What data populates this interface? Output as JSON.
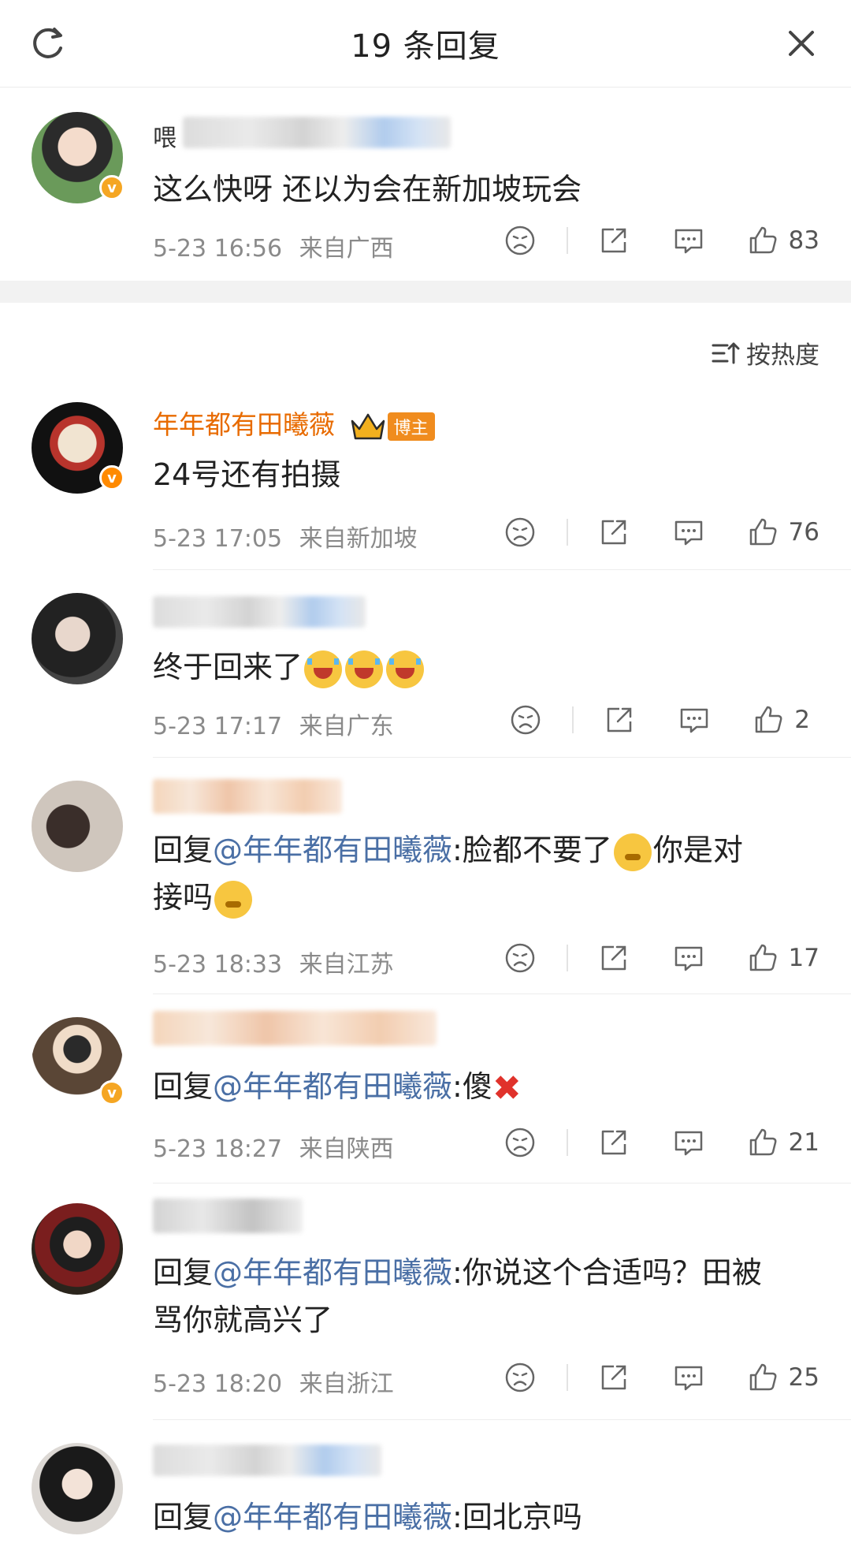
{
  "header": {
    "title": "19 条回复"
  },
  "root": {
    "name": "喂",
    "text": "这么快呀 还以为会在新加坡玩会",
    "time": "5-23 16:56",
    "location": "来自广西",
    "likes": "83"
  },
  "sort": {
    "label": "按热度"
  },
  "replies": [
    {
      "name": "年年都有田曦薇",
      "tag": "博主",
      "text": "24号还有拍摄",
      "time": "5-23 17:05",
      "location": "来自新加坡",
      "likes": "76"
    },
    {
      "name": "",
      "text": "终于回来了",
      "time": "5-23 17:17",
      "location": "来自广东",
      "likes": "2"
    },
    {
      "name": "",
      "reply_prefix": "回复",
      "mention": "@年年都有田曦薇",
      "text": ":脸都不要了",
      "text2": "你是对",
      "text3": "接吗",
      "time": "5-23 18:33",
      "location": "来自江苏",
      "likes": "17"
    },
    {
      "name": "",
      "reply_prefix": "回复",
      "mention": "@年年都有田曦薇",
      "text": ":傻",
      "time": "5-23 18:27",
      "location": "来自陕西",
      "likes": "21"
    },
    {
      "name": "",
      "reply_prefix": "回复",
      "mention": "@年年都有田曦薇",
      "text": ":你说这个合适吗？田被",
      "text2": "骂你就高兴了",
      "time": "5-23 18:20",
      "location": "来自浙江",
      "likes": "25"
    },
    {
      "name": "",
      "reply_prefix": "回复",
      "mention": "@年年都有田曦薇",
      "text": ":回北京吗"
    }
  ]
}
